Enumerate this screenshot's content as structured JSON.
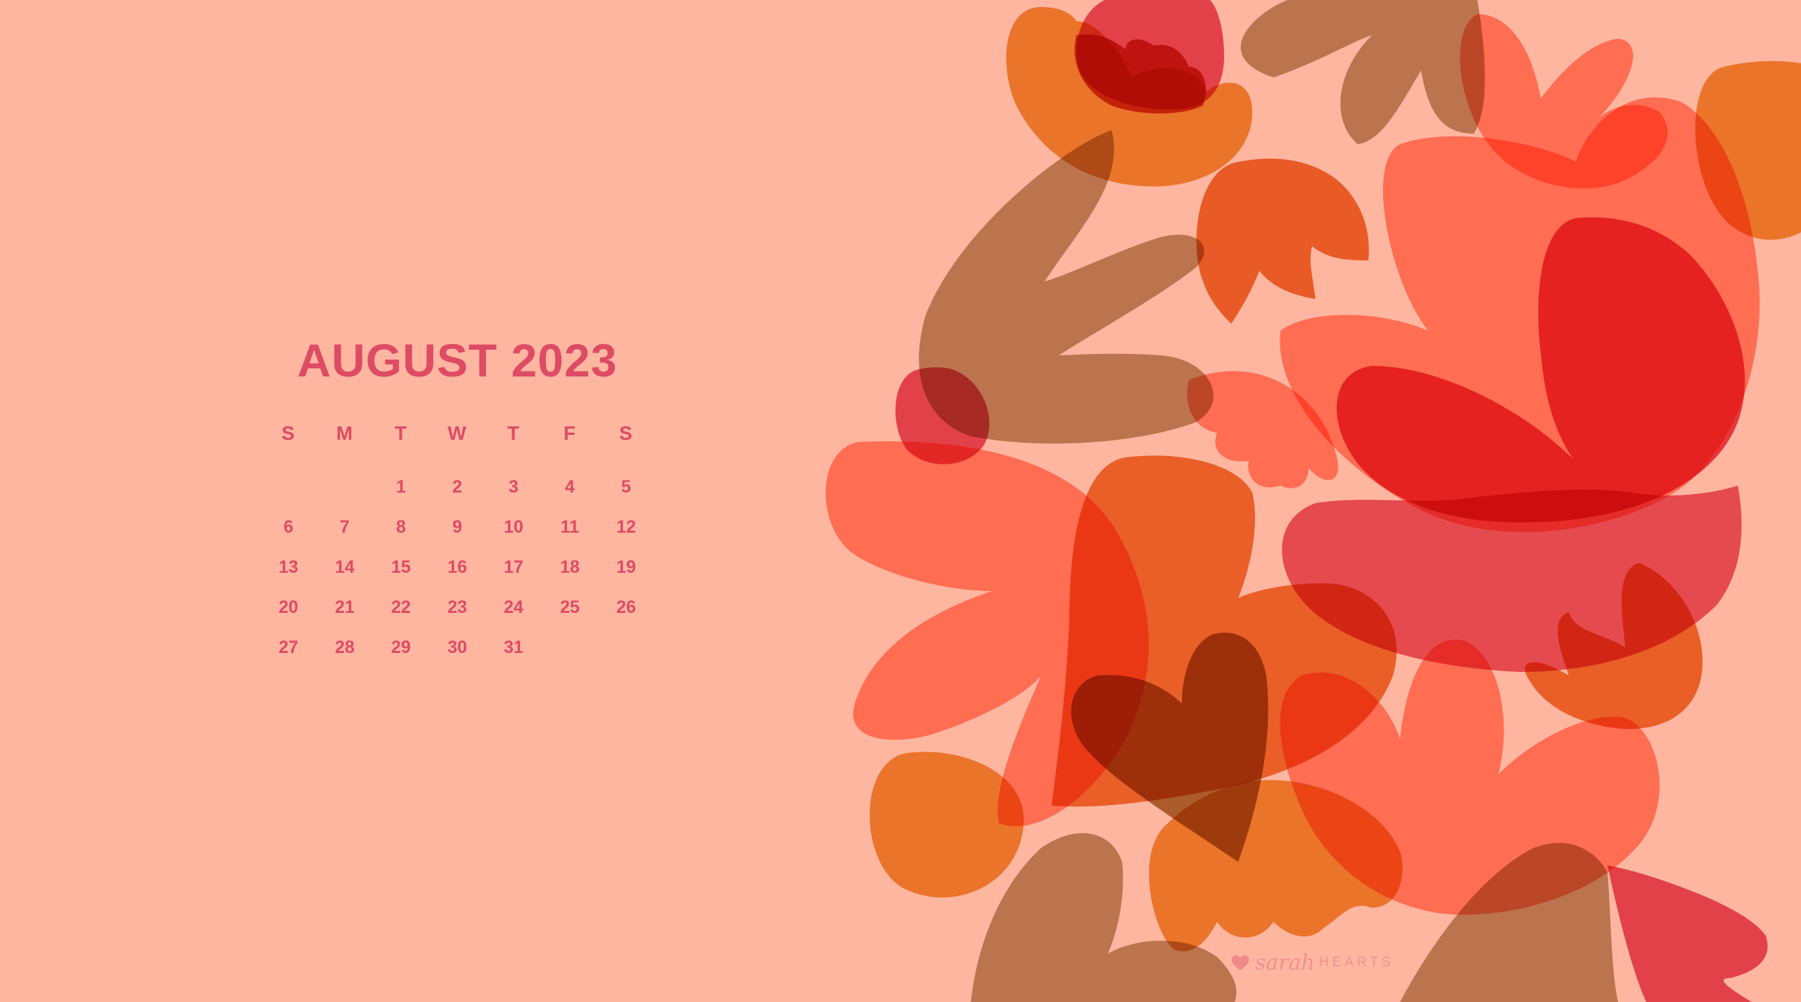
{
  "calendar": {
    "title": "AUGUST 2023",
    "weekdays": [
      "S",
      "M",
      "T",
      "W",
      "T",
      "F",
      "S"
    ],
    "days": [
      "",
      "",
      "1",
      "2",
      "3",
      "4",
      "5",
      "6",
      "7",
      "8",
      "9",
      "10",
      "11",
      "12",
      "13",
      "14",
      "15",
      "16",
      "17",
      "18",
      "19",
      "20",
      "21",
      "22",
      "23",
      "24",
      "25",
      "26",
      "27",
      "28",
      "29",
      "30",
      "31"
    ],
    "text_color": "#DE4B64"
  },
  "background_color": "#FFB6A1",
  "watermark": {
    "script": "sarah",
    "word": "HEARTS",
    "icon": "heart-icon"
  },
  "palette": {
    "olive": "#B79B71",
    "mustard": "#EA9A33",
    "orange": "#E8752A",
    "salmon": "#FF8E74",
    "pink": "#E2526B",
    "red": "#E33A4C"
  }
}
